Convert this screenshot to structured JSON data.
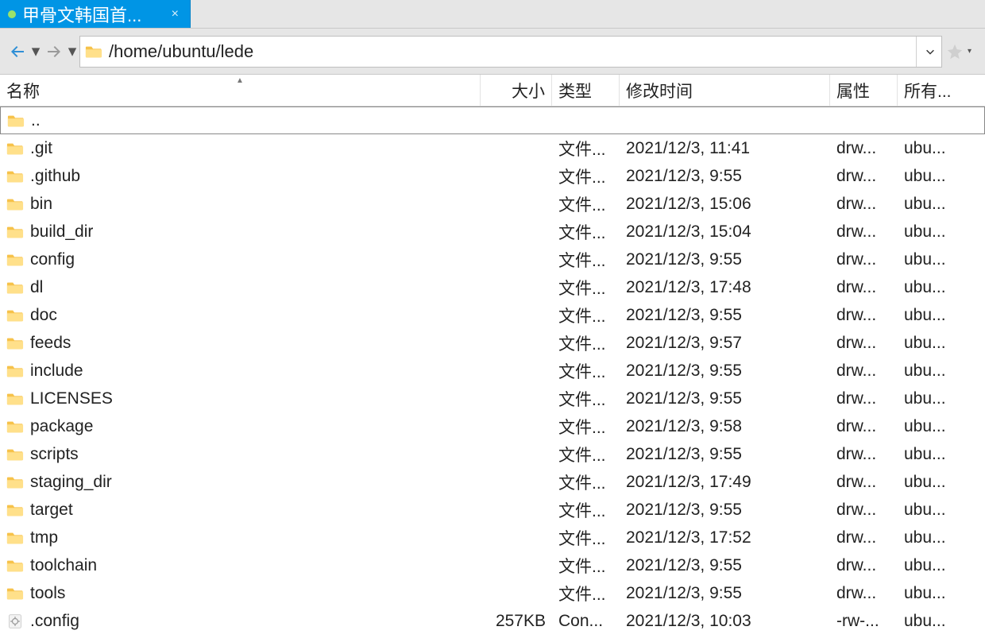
{
  "tab": {
    "title": "甲骨文韩国首...",
    "close_glyph": "×",
    "status_color": "#9be26a"
  },
  "toolbar": {
    "path": "/home/ubuntu/lede",
    "back_icon": "arrow-left-icon",
    "forward_icon": "arrow-right-icon",
    "dropdown_glyph": "▾",
    "chevron_glyph": "⌄",
    "star_glyph": "★"
  },
  "columns": {
    "name": "名称",
    "size": "大小",
    "type": "类型",
    "mtime": "修改时间",
    "perm": "属性",
    "owner": "所有...",
    "sort_column": "name",
    "sort_dir": "asc",
    "sort_glyph": "▲"
  },
  "rows": [
    {
      "name": "..",
      "icon": "folder",
      "size": "",
      "type": "",
      "mtime": "",
      "perm": "",
      "owner": "",
      "selected": true
    },
    {
      "name": ".git",
      "icon": "folder",
      "size": "",
      "type": "文件...",
      "mtime": "2021/12/3, 11:41",
      "perm": "drw...",
      "owner": "ubu..."
    },
    {
      "name": ".github",
      "icon": "folder",
      "size": "",
      "type": "文件...",
      "mtime": "2021/12/3, 9:55",
      "perm": "drw...",
      "owner": "ubu..."
    },
    {
      "name": "bin",
      "icon": "folder",
      "size": "",
      "type": "文件...",
      "mtime": "2021/12/3, 15:06",
      "perm": "drw...",
      "owner": "ubu..."
    },
    {
      "name": "build_dir",
      "icon": "folder",
      "size": "",
      "type": "文件...",
      "mtime": "2021/12/3, 15:04",
      "perm": "drw...",
      "owner": "ubu..."
    },
    {
      "name": "config",
      "icon": "folder",
      "size": "",
      "type": "文件...",
      "mtime": "2021/12/3, 9:55",
      "perm": "drw...",
      "owner": "ubu..."
    },
    {
      "name": "dl",
      "icon": "folder",
      "size": "",
      "type": "文件...",
      "mtime": "2021/12/3, 17:48",
      "perm": "drw...",
      "owner": "ubu..."
    },
    {
      "name": "doc",
      "icon": "folder",
      "size": "",
      "type": "文件...",
      "mtime": "2021/12/3, 9:55",
      "perm": "drw...",
      "owner": "ubu..."
    },
    {
      "name": "feeds",
      "icon": "folder",
      "size": "",
      "type": "文件...",
      "mtime": "2021/12/3, 9:57",
      "perm": "drw...",
      "owner": "ubu..."
    },
    {
      "name": "include",
      "icon": "folder",
      "size": "",
      "type": "文件...",
      "mtime": "2021/12/3, 9:55",
      "perm": "drw...",
      "owner": "ubu..."
    },
    {
      "name": "LICENSES",
      "icon": "folder",
      "size": "",
      "type": "文件...",
      "mtime": "2021/12/3, 9:55",
      "perm": "drw...",
      "owner": "ubu..."
    },
    {
      "name": "package",
      "icon": "folder",
      "size": "",
      "type": "文件...",
      "mtime": "2021/12/3, 9:58",
      "perm": "drw...",
      "owner": "ubu..."
    },
    {
      "name": "scripts",
      "icon": "folder",
      "size": "",
      "type": "文件...",
      "mtime": "2021/12/3, 9:55",
      "perm": "drw...",
      "owner": "ubu..."
    },
    {
      "name": "staging_dir",
      "icon": "folder",
      "size": "",
      "type": "文件...",
      "mtime": "2021/12/3, 17:49",
      "perm": "drw...",
      "owner": "ubu..."
    },
    {
      "name": "target",
      "icon": "folder",
      "size": "",
      "type": "文件...",
      "mtime": "2021/12/3, 9:55",
      "perm": "drw...",
      "owner": "ubu..."
    },
    {
      "name": "tmp",
      "icon": "folder",
      "size": "",
      "type": "文件...",
      "mtime": "2021/12/3, 17:52",
      "perm": "drw...",
      "owner": "ubu..."
    },
    {
      "name": "toolchain",
      "icon": "folder",
      "size": "",
      "type": "文件...",
      "mtime": "2021/12/3, 9:55",
      "perm": "drw...",
      "owner": "ubu..."
    },
    {
      "name": "tools",
      "icon": "folder",
      "size": "",
      "type": "文件...",
      "mtime": "2021/12/3, 9:55",
      "perm": "drw...",
      "owner": "ubu..."
    },
    {
      "name": ".config",
      "icon": "config",
      "size": "257KB",
      "type": "Con...",
      "mtime": "2021/12/3, 10:03",
      "perm": "-rw-...",
      "owner": "ubu..."
    }
  ]
}
